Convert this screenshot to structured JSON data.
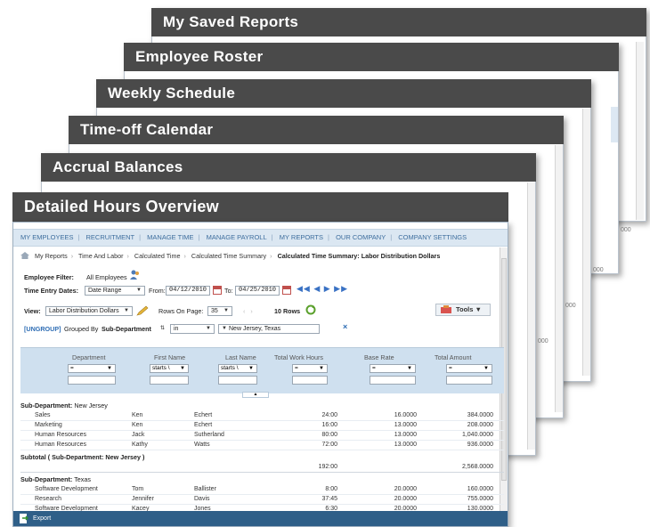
{
  "stack_titles": [
    "My Saved Reports",
    "Employee Roster",
    "Weekly Schedule",
    "Time-off Calendar",
    "Accrual Balances",
    "Detailed Hours Overview"
  ],
  "ghost_values": [
    "000",
    "000",
    "000",
    "000",
    "000"
  ],
  "nav": [
    "MY EMPLOYEES",
    "RECRUITMENT",
    "MANAGE TIME",
    "MANAGE PAYROLL",
    "MY REPORTS",
    "OUR COMPANY",
    "COMPANY SETTINGS"
  ],
  "breadcrumb": [
    "My Reports",
    "Time And Labor",
    "Calculated Time",
    "Calculated Time Summary",
    "Calculated Time Summary: Labor Distribution Dollars"
  ],
  "filter": {
    "employee_filter_label": "Employee Filter:",
    "employee_filter_value": "All Employees",
    "dates_label": "Time Entry Dates:",
    "dates_value": "Date Range",
    "from_label": "From:",
    "from_value": "04/12/2010",
    "to_label": "To:",
    "to_value": "04/25/2010"
  },
  "view": {
    "label": "View:",
    "value": "Labor Distribution Dollars",
    "rows_label": "Rows On Page:",
    "rows_value": "35",
    "rows_count": "10 Rows",
    "tools": "Tools"
  },
  "group": {
    "ungroup": "[UNGROUP]",
    "grouped_by": "Grouped By",
    "field": "Sub-Department",
    "op": "in",
    "value": "New Jersey, Texas",
    "clear": "×"
  },
  "columns": [
    "Department",
    "First Name",
    "Last Name",
    "Total Work Hours",
    "Base Rate",
    "Total Amount"
  ],
  "filters": [
    "=",
    "starts \\",
    "starts \\",
    "=",
    "=",
    "="
  ],
  "groups": [
    {
      "label": "Sub-Department:",
      "value": "New Jersey",
      "rows": [
        [
          "Sales",
          "Ken",
          "Echert",
          "24:00",
          "16.0000",
          "384.0000"
        ],
        [
          "Marketing",
          "Ken",
          "Echert",
          "16:00",
          "13.0000",
          "208.0000"
        ],
        [
          "Human Resources",
          "Jack",
          "Sutherland",
          "80:00",
          "13.0000",
          "1,040.0000"
        ],
        [
          "Human Resources",
          "Kathy",
          "Watts",
          "72:00",
          "13.0000",
          "936.0000"
        ]
      ],
      "subtotal_label": "Subtotal ( Sub-Department: New Jersey )",
      "subtotal_hours": "192:00",
      "subtotal_amount": "2,568.0000"
    },
    {
      "label": "Sub-Department:",
      "value": "Texas",
      "rows": [
        [
          "Software Development",
          "Tom",
          "Ballister",
          "8:00",
          "20.0000",
          "160.0000"
        ],
        [
          "Research",
          "Jennifer",
          "Davis",
          "37:45",
          "20.0000",
          "755.0000"
        ],
        [
          "Software Development",
          "Kacey",
          "Jones",
          "6:30",
          "20.0000",
          "130.0000"
        ]
      ]
    }
  ],
  "export_label": "Export",
  "colors": {
    "header_bg": "#4a4a4a",
    "nav_bg": "#dbe7f2",
    "grid_head": "#cfe0ef",
    "bottom_bar": "#2f5f88"
  }
}
